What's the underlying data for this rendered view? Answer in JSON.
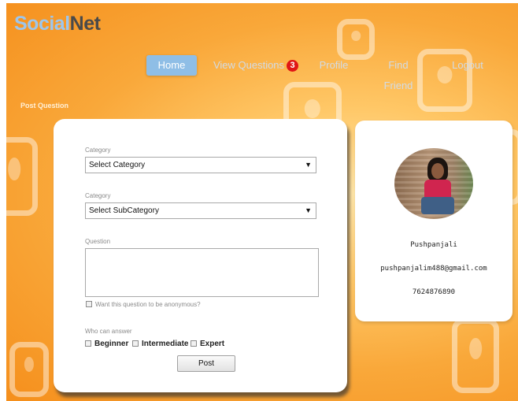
{
  "logo": {
    "part1": "Social",
    "part2": "Net"
  },
  "nav": {
    "home": "Home",
    "view_questions": "View Questions",
    "view_questions_badge": "3",
    "profile": "Profile",
    "find_friend": "Find Friend",
    "logout": "Logout"
  },
  "section_label": "Post Question",
  "form": {
    "category_label": "Category",
    "category_value": "Select Category",
    "subcategory_label": "Category",
    "subcategory_value": "Select SubCategory",
    "question_label": "Question",
    "question_value": "",
    "anonymous_label": "Want this question to be anonymous?",
    "who_can_answer_label": "Who can answer",
    "levels": [
      "Beginner",
      "Intermediate",
      "Expert"
    ],
    "post_button": "Post"
  },
  "profile": {
    "name": "Pushpanjali",
    "email": "pushpanjalim488@gmail.com",
    "phone": "7624876890"
  },
  "icons": {
    "dropdown": "chevron-down-icon"
  },
  "colors": {
    "accent": "#8fbee6",
    "badge": "#e01616",
    "background": "#f9a83a"
  }
}
